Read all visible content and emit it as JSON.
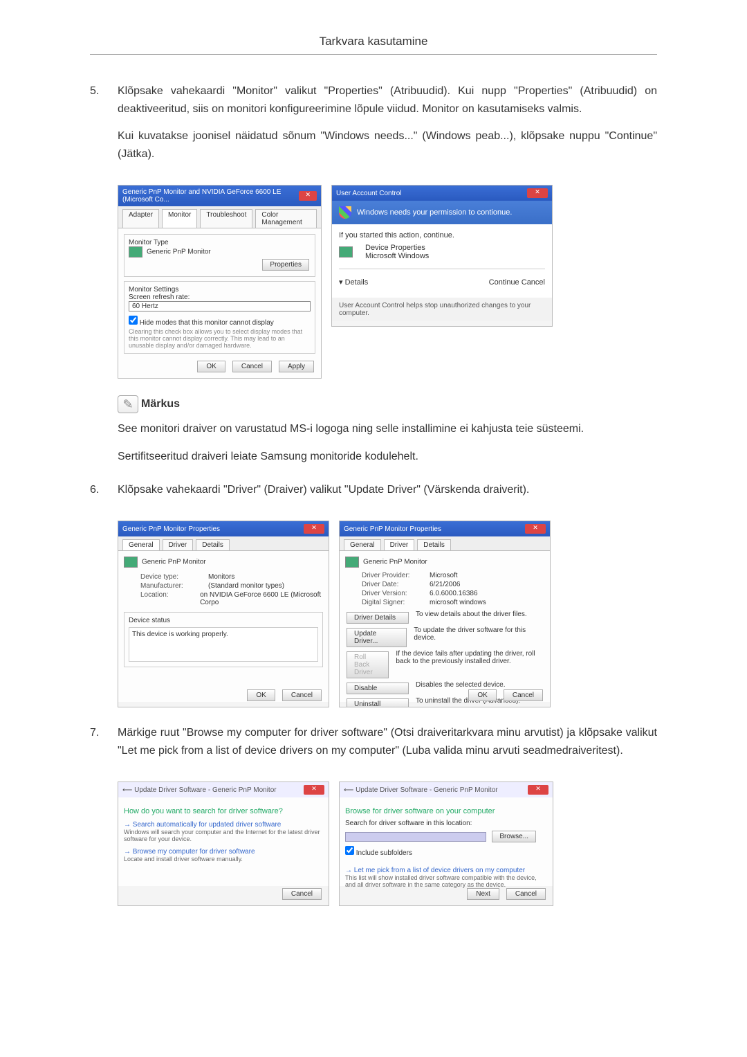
{
  "header": {
    "title": "Tarkvara kasutamine"
  },
  "steps": {
    "s5": {
      "num": "5.",
      "p1": "Klõpsake vahekaardi \"Monitor\" valikut \"Properties\" (Atribuudid). Kui nupp \"Properties\" (Atribuudid) on deaktiveeritud, siis on monitori konfigureerimine lõpule viidud. Monitor on kasutamiseks valmis.",
      "p2": "Kui kuvatakse joonisel näidatud sõnum \"Windows needs...\" (Windows peab...), klõpsake nuppu \"Continue\" (Jätka)."
    },
    "s6": {
      "num": "6.",
      "p1": "Klõpsake vahekaardi \"Driver\" (Draiver) valikut \"Update Driver\" (Värskenda draiverit)."
    },
    "s7": {
      "num": "7.",
      "p1": "Märkige ruut \"Browse my computer for driver software\" (Otsi draiveritarkvara minu arvutist) ja klõpsake valikut \"Let me pick from a list of device drivers on my computer\" (Luba valida minu arvuti seadmedraiveritest)."
    }
  },
  "note": {
    "label": "Märkus",
    "p1": "See monitori draiver on varustatud MS-i logoga ning selle installimine ei kahjusta teie süsteemi.",
    "p2": "Sertifitseeritud draiveri leiate Samsung monitoride kodulehelt."
  },
  "dlg": {
    "monitor": {
      "title": "Generic PnP Monitor and NVIDIA GeForce 6600 LE (Microsoft Co...",
      "tabs": {
        "adapter": "Adapter",
        "monitor": "Monitor",
        "troubleshoot": "Troubleshoot",
        "color": "Color Management"
      },
      "monitorType": "Monitor Type",
      "monitorName": "Generic PnP Monitor",
      "propertiesBtn": "Properties",
      "monitorSettings": "Monitor Settings",
      "refreshLabel": "Screen refresh rate:",
      "refreshValue": "60 Hertz",
      "hideModes": "Hide modes that this monitor cannot display",
      "hideText": "Clearing this check box allows you to select display modes that this monitor cannot display correctly. This may lead to an unusable display and/or damaged hardware.",
      "ok": "OK",
      "cancel": "Cancel",
      "apply": "Apply"
    },
    "uac": {
      "title": "User Account Control",
      "banner": "Windows needs your permission to contionue.",
      "ifYou": "If you started this action, continue.",
      "devProps": "Device Properties",
      "msWin": "Microsoft Windows",
      "details": "Details",
      "continue": "Continue",
      "cancel": "Cancel",
      "footer": "User Account Control helps stop unauthorized changes to your computer."
    },
    "propGeneral": {
      "title": "Generic PnP Monitor Properties",
      "tabs": {
        "general": "General",
        "driver": "Driver",
        "details": "Details"
      },
      "name": "Generic PnP Monitor",
      "deviceType": "Device type:",
      "deviceTypeVal": "Monitors",
      "manufacturer": "Manufacturer:",
      "manufacturerVal": "(Standard monitor types)",
      "location": "Location:",
      "locationVal": "on NVIDIA GeForce 6600 LE (Microsoft Corpo",
      "deviceStatus": "Device status",
      "working": "This device is working properly.",
      "ok": "OK",
      "cancel": "Cancel"
    },
    "propDriver": {
      "title": "Generic PnP Monitor Properties",
      "name": "Generic PnP Monitor",
      "provider": "Driver Provider:",
      "providerVal": "Microsoft",
      "date": "Driver Date:",
      "dateVal": "6/21/2006",
      "version": "Driver Version:",
      "versionVal": "6.0.6000.16386",
      "signer": "Digital Signer:",
      "signerVal": "microsoft windows",
      "driverDetails": "Driver Details",
      "driverDetailsTxt": "To view details about the driver files.",
      "updateDriver": "Update Driver...",
      "updateDriverTxt": "To update the driver software for this device.",
      "rollBack": "Roll Back Driver",
      "rollBackTxt": "If the device fails after updating the driver, roll back to the previously installed driver.",
      "disable": "Disable",
      "disableTxt": "Disables the selected device.",
      "uninstall": "Uninstall",
      "uninstallTxt": "To uninstall the driver (Advanced).",
      "ok": "OK",
      "cancel": "Cancel"
    },
    "wizard1": {
      "header": "Update Driver Software - Generic PnP Monitor",
      "question": "How do you want to search for driver software?",
      "opt1": "Search automatically for updated driver software",
      "opt1sub": "Windows will search your computer and the Internet for the latest driver software for your device.",
      "opt2": "Browse my computer for driver software",
      "opt2sub": "Locate and install driver software manually.",
      "cancel": "Cancel"
    },
    "wizard2": {
      "header": "Update Driver Software - Generic PnP Monitor",
      "browseHeading": "Browse for driver software on your computer",
      "searchLabel": "Search for driver software in this location:",
      "browse": "Browse...",
      "include": "Include subfolders",
      "opt": "Let me pick from a list of device drivers on my computer",
      "optsub": "This list will show installed driver software compatible with the device, and all driver software in the same category as the device.",
      "next": "Next",
      "cancel": "Cancel"
    }
  }
}
